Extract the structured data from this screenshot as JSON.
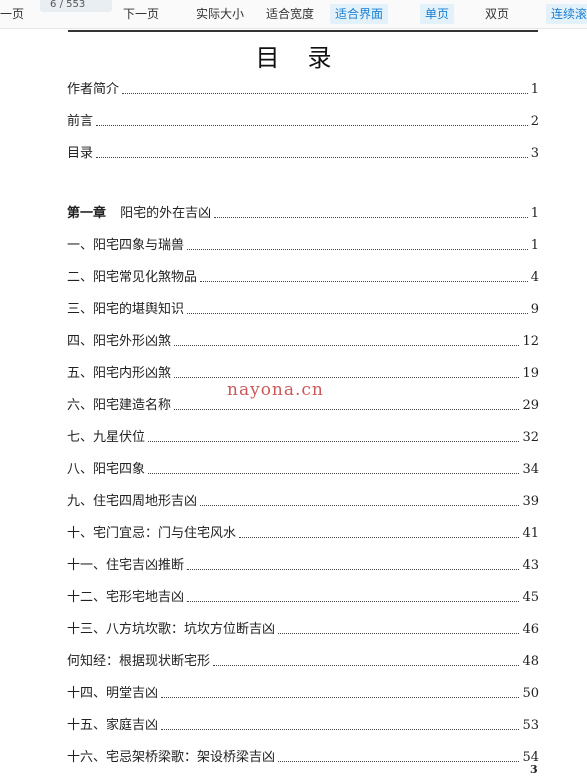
{
  "toolbar": {
    "prev_page": "一页",
    "page_current": "6",
    "page_total": "/ 553",
    "next_page": "下一页",
    "actual_size": "实际大小",
    "fit_width": "适合宽度",
    "fit_page": "适合界面",
    "single_page": "单页",
    "double_page": "双页",
    "continuous": "连续滚"
  },
  "page": {
    "title": "目录",
    "watermark": "nayona.cn",
    "page_number": "3"
  },
  "toc": {
    "front": [
      {
        "label": "作者简介",
        "page": "1"
      },
      {
        "label": "前言",
        "page": "2"
      },
      {
        "label": "目录",
        "page": "3"
      }
    ],
    "chapter": {
      "chapter_label": "第一章",
      "title": "阳宅的外在吉凶",
      "page": "1"
    },
    "sections": [
      {
        "label": "一、阳宅四象与瑞兽",
        "page": "1"
      },
      {
        "label": "二、阳宅常见化煞物品",
        "page": "4"
      },
      {
        "label": "三、阳宅的堪舆知识",
        "page": "9"
      },
      {
        "label": "四、阳宅外形凶煞",
        "page": "12"
      },
      {
        "label": "五、阳宅内形凶煞",
        "page": "19"
      },
      {
        "label": "六、阳宅建造名称",
        "page": "29"
      },
      {
        "label": "七、九星伏位",
        "page": "32"
      },
      {
        "label": "八、阳宅四象",
        "page": "34"
      },
      {
        "label": "九、住宅四周地形吉凶",
        "page": "39"
      },
      {
        "label": "十、宅门宜忌：门与住宅风水",
        "page": "41"
      },
      {
        "label": "十一、住宅吉凶推断",
        "page": "43"
      },
      {
        "label": "十二、宅形宅地吉凶",
        "page": "45"
      },
      {
        "label": "十三、八方坑坎歌：坑坎方位断吉凶",
        "page": "46"
      },
      {
        "label": "何知经：根据现状断宅形",
        "page": "48"
      },
      {
        "label": "十四、明堂吉凶",
        "page": "50"
      },
      {
        "label": "十五、家庭吉凶",
        "page": "53"
      },
      {
        "label": "十六、宅忌架桥梁歌：架设桥梁吉凶",
        "page": "54"
      }
    ]
  }
}
